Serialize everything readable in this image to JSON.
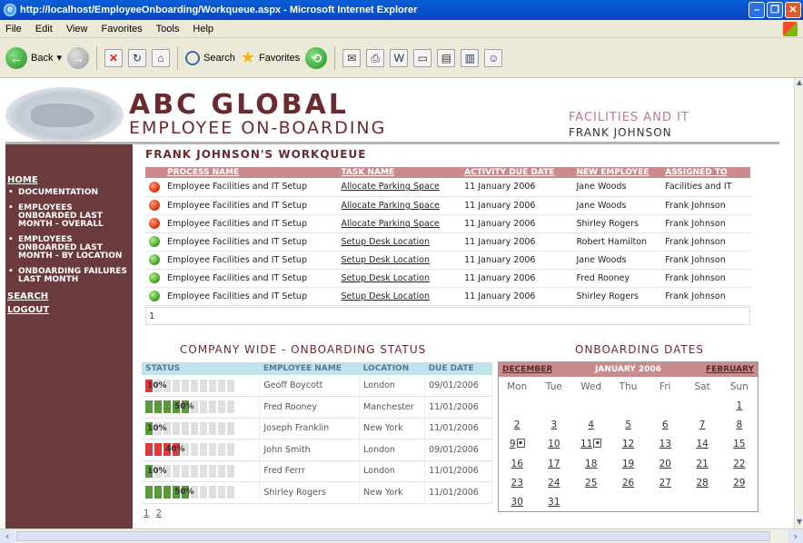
{
  "window": {
    "title": "http://localhost/EmployeeOnboarding/Workqueue.aspx - Microsoft Internet Explorer"
  },
  "menu": [
    "File",
    "Edit",
    "View",
    "Favorites",
    "Tools",
    "Help"
  ],
  "toolbar": {
    "back": "Back",
    "search": "Search",
    "favorites": "Favorites"
  },
  "brand": {
    "title": "ABC GLOBAL",
    "subtitle": "EMPLOYEE ON-BOARDING",
    "department": "FACILITIES AND IT",
    "user": "FRANK JOHNSON"
  },
  "sidebar": {
    "home": "HOME",
    "items": [
      "DOCUMENTATION",
      "EMPLOYEES ONBOARDED LAST MONTH - OVERALL",
      "EMPLOYEES ONBOARDED LAST MONTH - BY LOCATION",
      "ONBOARDING FAILURES LAST MONTH"
    ],
    "search": "SEARCH",
    "logout": "LOGOUT"
  },
  "workqueue": {
    "title": "FRANK JOHNSON'S WORKQUEUE",
    "columns": [
      "PROCESS NAME",
      "TASK NAME",
      "ACTIVITY DUE DATE",
      "NEW EMPLOYEE",
      "ASSIGNED TO"
    ],
    "rows": [
      {
        "status": "red",
        "process": "Employee Facilities and IT Setup",
        "task": "Allocate Parking Space",
        "due": "11 January 2006",
        "employee": "Jane Woods",
        "assigned": "Facilities and IT"
      },
      {
        "status": "red",
        "process": "Employee Facilities and IT Setup",
        "task": "Allocate Parking Space",
        "due": "11 January 2006",
        "employee": "Jane Woods",
        "assigned": "Frank Johnson"
      },
      {
        "status": "red",
        "process": "Employee Facilities and IT Setup",
        "task": "Allocate Parking Space",
        "due": "11 January 2006",
        "employee": "Shirley Rogers",
        "assigned": "Frank Johnson"
      },
      {
        "status": "green",
        "process": "Employee Facilities and IT Setup",
        "task": "Setup Desk Location",
        "due": "11 January 2006",
        "employee": "Robert Hamilton",
        "assigned": "Frank Johnson"
      },
      {
        "status": "green",
        "process": "Employee Facilities and IT Setup",
        "task": "Setup Desk Location",
        "due": "11 January 2006",
        "employee": "Jane Woods",
        "assigned": "Frank Johnson"
      },
      {
        "status": "green",
        "process": "Employee Facilities and IT Setup",
        "task": "Setup Desk Location",
        "due": "11 January 2006",
        "employee": "Fred Rooney",
        "assigned": "Frank Johnson"
      },
      {
        "status": "green",
        "process": "Employee Facilities and IT Setup",
        "task": "Setup Desk Location",
        "due": "11 January 2006",
        "employee": "Shirley Rogers",
        "assigned": "Frank Johnson"
      }
    ],
    "page": "1"
  },
  "status_panel": {
    "title": "COMPANY WIDE - ONBOARDING STATUS",
    "columns": [
      "STATUS",
      "EMPLOYEE NAME",
      "LOCATION",
      "DUE DATE"
    ],
    "rows": [
      {
        "progress": "10%",
        "fraction": 0.1,
        "color": "#e03a3a",
        "name": "Geoff Boycott",
        "location": "London",
        "due": "09/01/2006"
      },
      {
        "progress": "50%",
        "fraction": 0.5,
        "color": "#5a9a3a",
        "name": "Fred Rooney",
        "location": "Manchester",
        "due": "11/01/2006"
      },
      {
        "progress": "10%",
        "fraction": 0.1,
        "color": "#5a9a3a",
        "name": "Joseph Franklin",
        "location": "New York",
        "due": "11/01/2006"
      },
      {
        "progress": "40%",
        "fraction": 0.4,
        "color": "#e03a3a",
        "name": "John Smith",
        "location": "London",
        "due": "09/01/2006"
      },
      {
        "progress": "10%",
        "fraction": 0.1,
        "color": "#5a9a3a",
        "name": "Fred Ferrr",
        "location": "London",
        "due": "11/01/2006"
      },
      {
        "progress": "50%",
        "fraction": 0.5,
        "color": "#5a9a3a",
        "name": "Shirley Rogers",
        "location": "New York",
        "due": "11/01/2006"
      }
    ],
    "pages": [
      "1",
      "2"
    ]
  },
  "calendar": {
    "title": "ONBOARDING DATES",
    "prev": "DECEMBER",
    "month": "JANUARY 2006",
    "next": "FEBRUARY",
    "weekdays": [
      "Mon",
      "Tue",
      "Wed",
      "Thu",
      "Fri",
      "Sat",
      "Sun"
    ],
    "weeks": [
      [
        "",
        "",
        "",
        "",
        "",
        "",
        "1"
      ],
      [
        "2",
        "3",
        "4",
        "5",
        "6",
        "7",
        "8"
      ],
      [
        "9",
        "10",
        "11",
        "12",
        "13",
        "14",
        "15"
      ],
      [
        "16",
        "17",
        "18",
        "19",
        "20",
        "21",
        "22"
      ],
      [
        "23",
        "24",
        "25",
        "26",
        "27",
        "28",
        "29"
      ],
      [
        "30",
        "31",
        "",
        "",
        "",
        "",
        ""
      ]
    ],
    "event_days": [
      "9",
      "11"
    ]
  }
}
